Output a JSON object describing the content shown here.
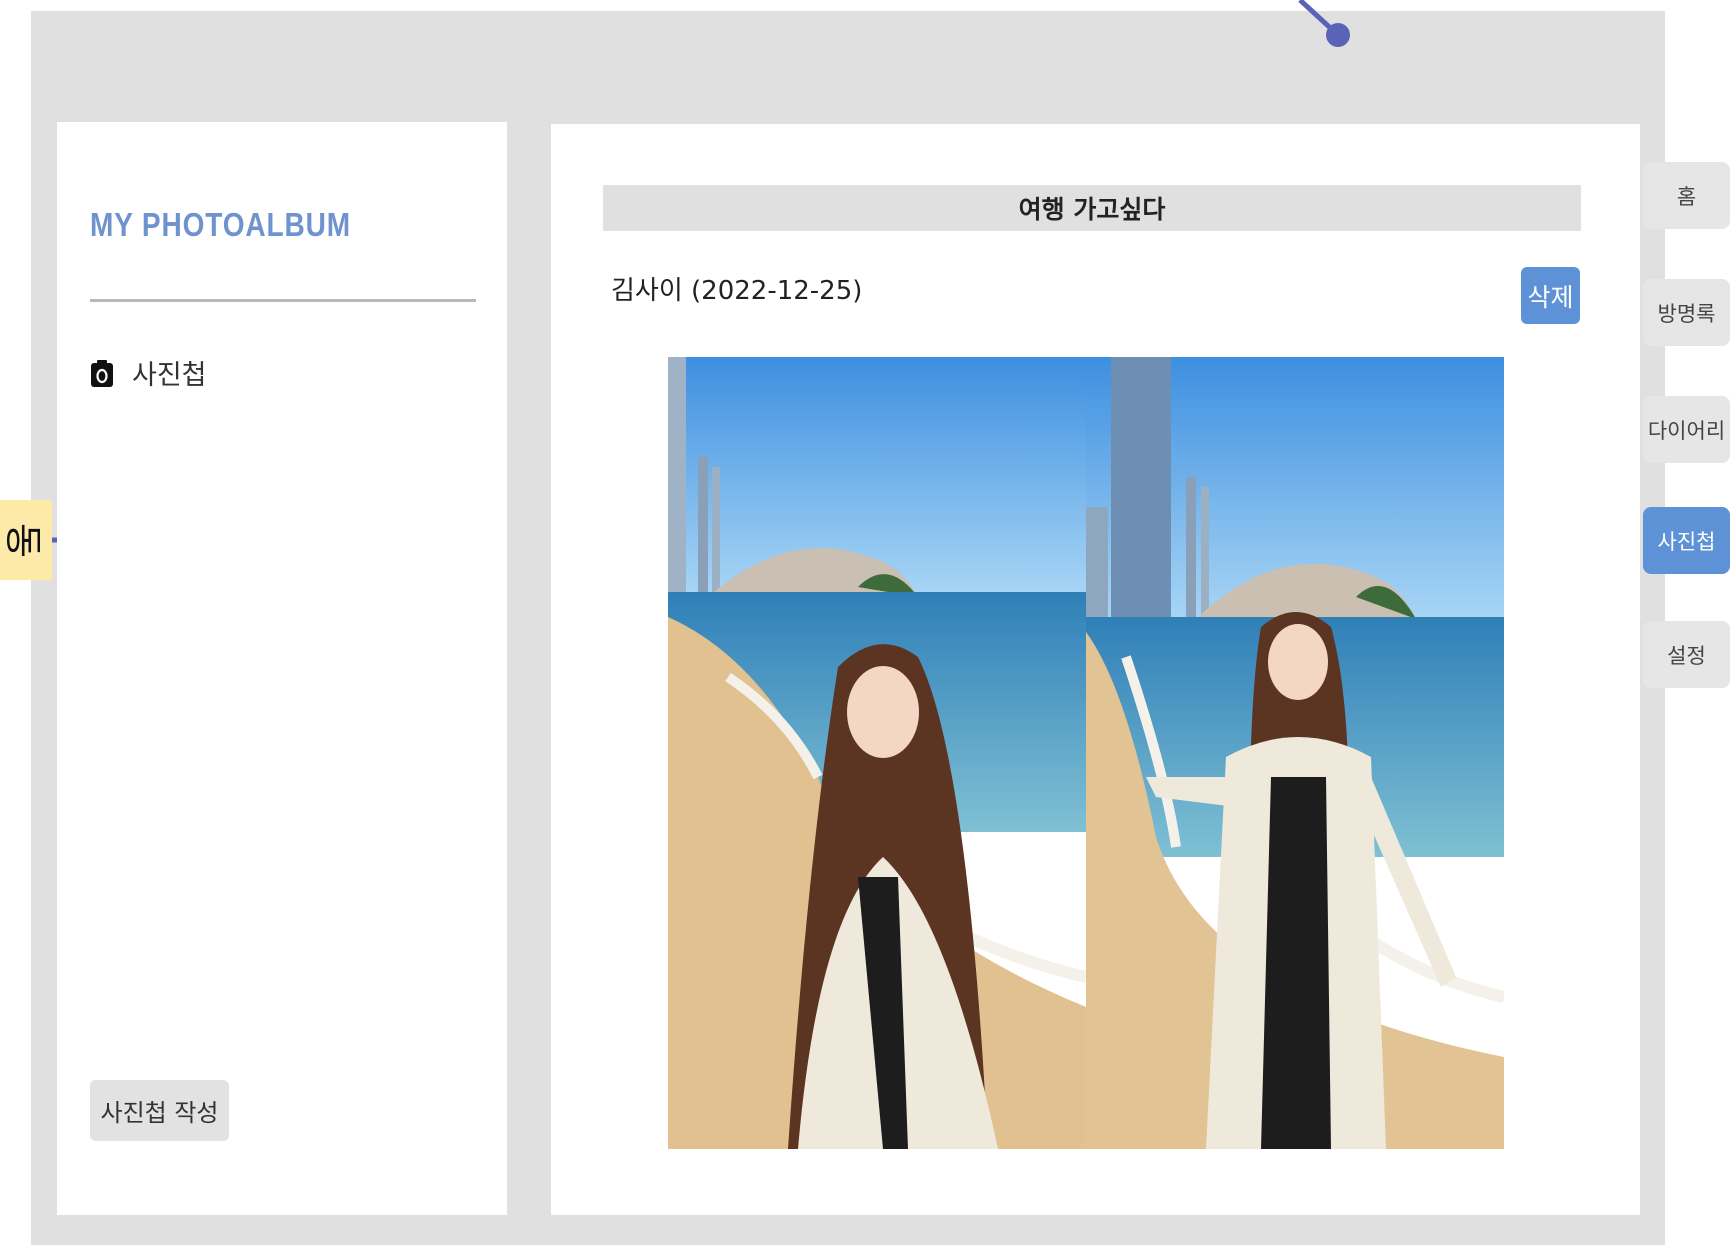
{
  "colors": {
    "accent": "#5e92d6",
    "title": "#6f93cf",
    "frame": "#e0e0e0",
    "string": "#5b63b8",
    "sticker": "#fde9a8"
  },
  "sidebar": {
    "title": "MY  PHOTOALBUM",
    "menu": [
      {
        "icon": "camera-icon",
        "label": "사진첩"
      }
    ],
    "write_button": "사진첩 작성"
  },
  "post": {
    "title": "여행 가고싶다",
    "meta": "김사이 (2022-12-25)",
    "delete_button": "삭제",
    "photos": [
      "beach-photo-1",
      "beach-photo-2"
    ]
  },
  "side_tabs": [
    {
      "label": "홈",
      "active": false
    },
    {
      "label": "방명록",
      "active": false
    },
    {
      "label": "다이어리",
      "active": false
    },
    {
      "label": "사진첩",
      "active": true
    },
    {
      "label": "설정",
      "active": false
    }
  ],
  "sticker": {
    "text": "동"
  }
}
